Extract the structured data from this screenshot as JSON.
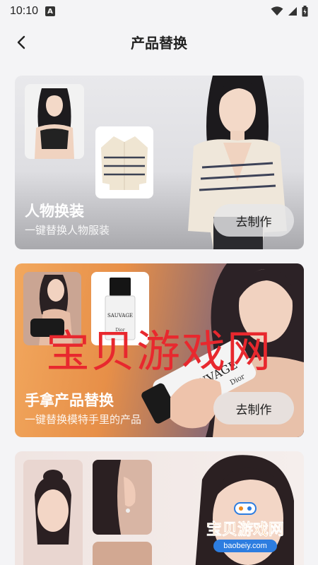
{
  "status": {
    "time": "10:10",
    "notif_letter": "A"
  },
  "header": {
    "title": "产品替换"
  },
  "cards": [
    {
      "title": "人物换装",
      "subtitle": "一键替换人物服装",
      "button": "去制作"
    },
    {
      "title": "手拿产品替换",
      "subtitle": "一键替换模特手里的产品",
      "button": "去制作"
    }
  ],
  "product_labels": {
    "bottle": "SAUVAGE",
    "brand": "Dior"
  },
  "watermark": {
    "big": "宝贝游戏网",
    "logo": "宝贝游戏网",
    "url": "baobeiy.com"
  },
  "colors": {
    "accent_red": "#e8282e",
    "logo_orange": "#f08a1c",
    "logo_blue": "#2d7de0"
  }
}
